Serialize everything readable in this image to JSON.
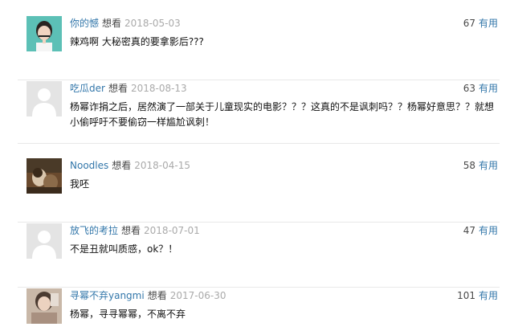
{
  "comments": [
    {
      "user": "你的憾",
      "rating_label": "想看",
      "date": "2018-05-03",
      "votes": "67",
      "useful_label": "有用",
      "text": "辣鸡啊 大秘密真的要拿影后???",
      "avatar": "photo-avatar-girl"
    },
    {
      "user": "吃瓜der",
      "rating_label": "想看",
      "date": "2018-08-13",
      "votes": "63",
      "useful_label": "有用",
      "text": "杨幂诈捐之后，居然演了一部关于儿童现实的电影？？？这真的不是讽刺吗？？杨幂好意思？？就想小偷呼吁不要偷窃一样尴尬讽刺！",
      "avatar": "default-avatar"
    },
    {
      "user": "Noodles",
      "rating_label": "想看",
      "date": "2018-04-15",
      "votes": "58",
      "useful_label": "有用",
      "text": "我呸",
      "avatar": "photo-avatar-painting"
    },
    {
      "user": "放飞的考拉",
      "rating_label": "想看",
      "date": "2018-07-01",
      "votes": "47",
      "useful_label": "有用",
      "text": "不是丑就叫质感，ok？！",
      "avatar": "default-avatar"
    },
    {
      "user": "寻幂不弃yangmi",
      "rating_label": "想看",
      "date": "2017-06-30",
      "votes": "101",
      "useful_label": "有用",
      "text": "杨幂，寻寻幂幂，不离不弃",
      "avatar": "photo-avatar-woman"
    }
  ]
}
